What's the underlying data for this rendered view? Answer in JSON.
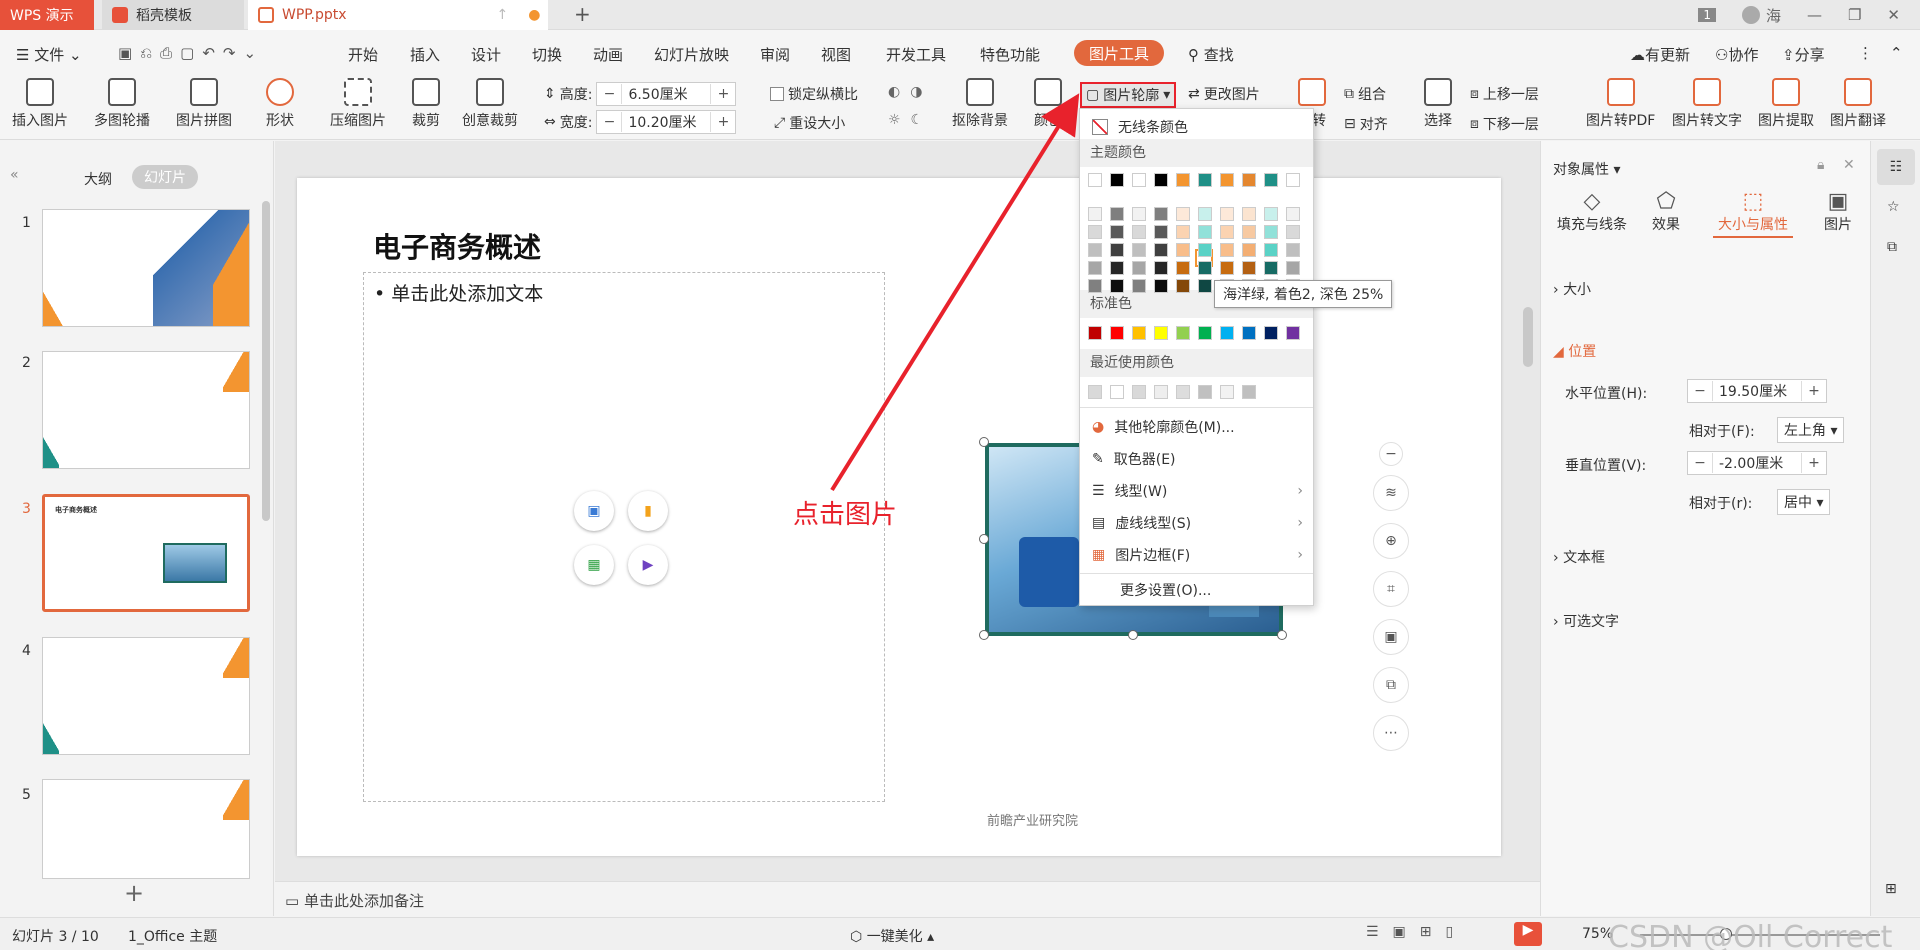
{
  "titlebar": {
    "app_tab": "WPS 演示",
    "template_tab": "稻壳模板",
    "file_tab": "WPP.pptx",
    "new_tab_symbol": "+",
    "badge": "1",
    "user": "海"
  },
  "menubar": {
    "file": "文件",
    "items": [
      "开始",
      "插入",
      "设计",
      "切换",
      "动画",
      "幻灯片放映",
      "审阅",
      "视图",
      "开发工具",
      "特色功能"
    ],
    "picture_tools": "图片工具",
    "search": "查找",
    "update": "有更新",
    "collab": "协作",
    "share": "分享"
  },
  "ribbon": {
    "insert_picture": "插入图片",
    "multi_carousel": "多图轮播",
    "picture_collage": "图片拼图",
    "shape": "形状",
    "compress": "压缩图片",
    "crop": "裁剪",
    "creative_crop": "创意裁剪",
    "height_label": "高度:",
    "height_value": "6.50厘米",
    "width_label": "宽度:",
    "width_value": "10.20厘米",
    "lock_ratio": "锁定纵横比",
    "reset_size": "重设大小",
    "remove_bg": "抠除背景",
    "color": "颜色",
    "outline": "图片轮廓",
    "change_picture": "更改图片",
    "rotate": "旋转",
    "group": "组合",
    "align": "对齐",
    "select": "选择",
    "bring_forward": "上移一层",
    "send_backward": "下移一层",
    "to_pdf": "图片转PDF",
    "to_text": "图片转文字",
    "extract": "图片提取",
    "translate": "图片翻译"
  },
  "leftpanel": {
    "outline_tab": "大纲",
    "slides_tab": "幻灯片",
    "numbers": [
      "1",
      "2",
      "3",
      "4",
      "5"
    ],
    "add_symbol": "+"
  },
  "slide": {
    "title": "电子商务概述",
    "bullet": "单击此处添加文本",
    "footer": "前瞻产业研究院",
    "annotation": "点击图片",
    "thumb3_title": "电子商务概述"
  },
  "dropdown": {
    "no_line": "无线条颜色",
    "theme_colors": "主题颜色",
    "standard_colors": "标准色",
    "recent_colors": "最近使用颜色",
    "other_colors": "其他轮廓颜色(M)...",
    "eyedropper": "取色器(E)",
    "line_type": "线型(W)",
    "dash_type": "虚线线型(S)",
    "border": "图片边框(F)",
    "more_settings": "更多设置(O)...",
    "tooltip": "海洋绿, 着色2, 深色 25%",
    "theme_top": [
      "#ffffff",
      "#000000",
      "#ffffff",
      "#000000",
      "#f39530",
      "#1f9087",
      "#f39530",
      "#e4872f",
      "#1f9087",
      "#ffffff"
    ],
    "standard": [
      "#c00000",
      "#ff0000",
      "#ffc000",
      "#ffff00",
      "#92d050",
      "#00b050",
      "#00b0f0",
      "#0070c0",
      "#002060",
      "#7030a0"
    ],
    "recent": [
      "#d9d9d9",
      "#ffffff",
      "#d9d9d9",
      "#eeeeee",
      "#dddddd",
      "#c0c0c0",
      "#f2f2f2",
      "#bfbfbf"
    ]
  },
  "rightpanel": {
    "header": "对象属性",
    "tabs": [
      "填充与线条",
      "效果",
      "大小与属性",
      "图片"
    ],
    "size": "大小",
    "position": "位置",
    "h_pos_label": "水平位置(H):",
    "h_pos_value": "19.50厘米",
    "relative_label": "相对于(F):",
    "relative_value": "左上角",
    "v_pos_label": "垂直位置(V):",
    "v_pos_value": "-2.00厘米",
    "relative_r_label": "相对于(r):",
    "relative_r_value": "居中",
    "textbox": "文本框",
    "alt_text": "可选文字"
  },
  "notes": {
    "placeholder": "单击此处添加备注"
  },
  "statusbar": {
    "slide_info": "幻灯片 3 / 10",
    "theme": "1_Office 主题",
    "beautify": "一键美化",
    "zoom": "75%",
    "watermark": "CSDN @Oll Correct"
  },
  "colors": {
    "accent": "#e2683d",
    "teal": "#1f9087",
    "orange": "#f39530",
    "arrow": "#e8222c"
  }
}
